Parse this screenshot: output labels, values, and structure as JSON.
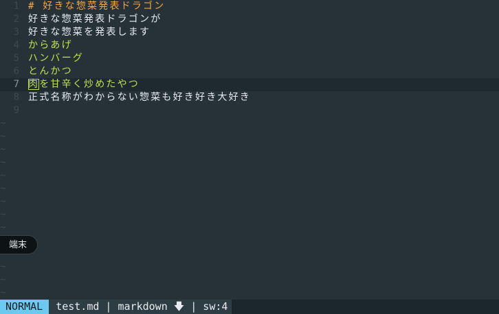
{
  "editor": {
    "lines": [
      {
        "number": "1",
        "text": "# 好きな惣菜発表ドラゴン"
      },
      {
        "number": "2",
        "text": "好きな惣菜発表ドラゴンが"
      },
      {
        "number": "3",
        "text": "好きな惣菜を発表します"
      },
      {
        "number": "4",
        "text": "からあげ"
      },
      {
        "number": "5",
        "text": "ハンバーグ"
      },
      {
        "number": "6",
        "text": "とんかつ"
      },
      {
        "number": "7",
        "cursor_char": "肉",
        "rest": "を甘辛く炒めたやつ"
      },
      {
        "number": "8",
        "text": "正式名称がわからない惣菜も好き好き大好き"
      },
      {
        "number": "9",
        "text": ""
      }
    ],
    "tilde": "~"
  },
  "tooltip": {
    "text": "端末"
  },
  "statusbar": {
    "mode": "NORMAL",
    "fileinfo": "test.md | markdown 🡇 | sw:4"
  }
}
